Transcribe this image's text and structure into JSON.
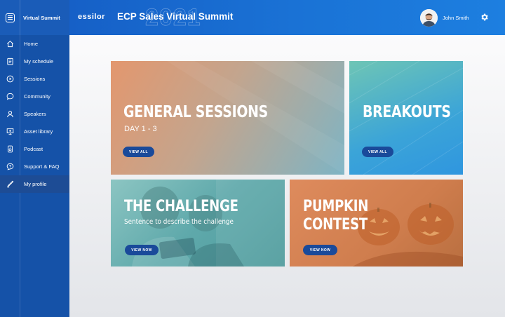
{
  "app": {
    "title": "Virtual Summit"
  },
  "header": {
    "brand": "essilor",
    "title": "ECP Sales Virtual Summit",
    "year_watermark": "2021",
    "user_name": "John Smith"
  },
  "sidebar": {
    "items": [
      {
        "label": "Home",
        "icon": "home-icon"
      },
      {
        "label": "My schedule",
        "icon": "schedule-icon"
      },
      {
        "label": "Sessions",
        "icon": "play-icon"
      },
      {
        "label": "Community",
        "icon": "chat-icon"
      },
      {
        "label": "Speakers",
        "icon": "person-icon"
      },
      {
        "label": "Asset library",
        "icon": "presentation-icon"
      },
      {
        "label": "Podcast",
        "icon": "speaker-icon"
      },
      {
        "label": "Support & FAQ",
        "icon": "help-icon"
      },
      {
        "label": "My profile",
        "icon": "pen-icon",
        "active": true
      }
    ]
  },
  "cards": {
    "general": {
      "title": "GENERAL SESSIONS",
      "subtitle": "DAY 1 - 3",
      "button": "VIEW ALL"
    },
    "breakouts": {
      "title": "BREAKOUTS",
      "button": "VIEW ALL"
    },
    "challenge": {
      "title": "THE CHALLENGE",
      "subtitle": "Sentence to describe the challenge",
      "button": "VIEW NOW"
    },
    "pumpkin": {
      "title_line1": "PUMPKIN",
      "title_line2": "CONTEST",
      "button": "VIEW NOW"
    }
  },
  "colors": {
    "sidebar": "#1552a8",
    "header": "#1a73d6",
    "button": "#1a4a9a"
  }
}
